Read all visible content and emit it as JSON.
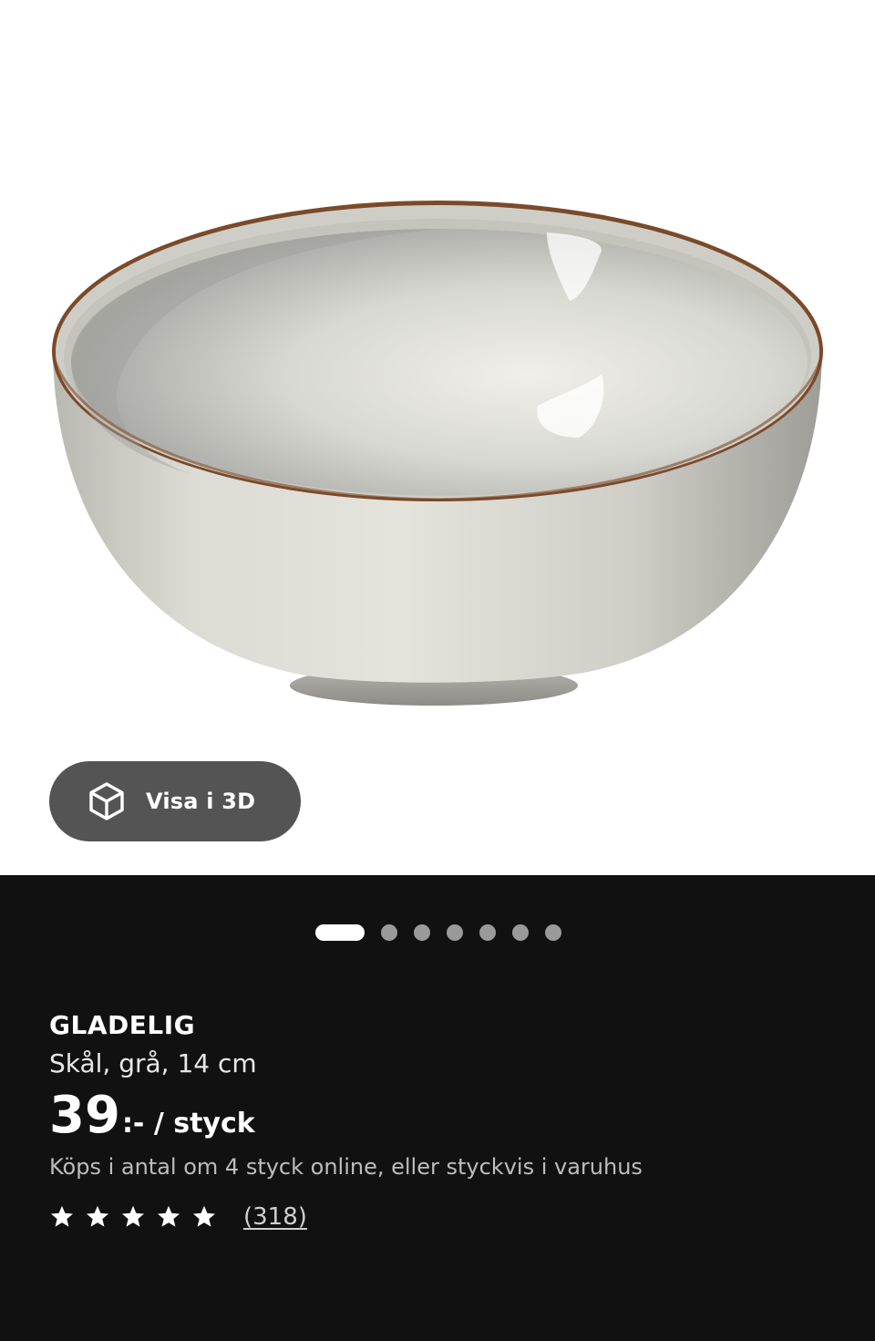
{
  "product_image": {
    "icon": "bowl-product-image"
  },
  "view_3d_button": {
    "label": "Visa i 3D",
    "icon": "cube-3d-icon"
  },
  "gallery_pager": {
    "total": 7,
    "active_index": 0
  },
  "product": {
    "name": "GLADELIG",
    "description": "Skål, grå, 14 cm",
    "price_amount": "39",
    "price_unit": ":- / styck",
    "purchase_note": "Köps i antal om 4 styck online, eller styckvis i varuhus",
    "rating": {
      "stars": 5,
      "max_stars": 5,
      "review_count": "(318)"
    }
  },
  "colors": {
    "info_background": "#111111",
    "button_background": "#545454",
    "pager_active": "#ffffff",
    "pager_inactive": "#9a9a9a"
  }
}
